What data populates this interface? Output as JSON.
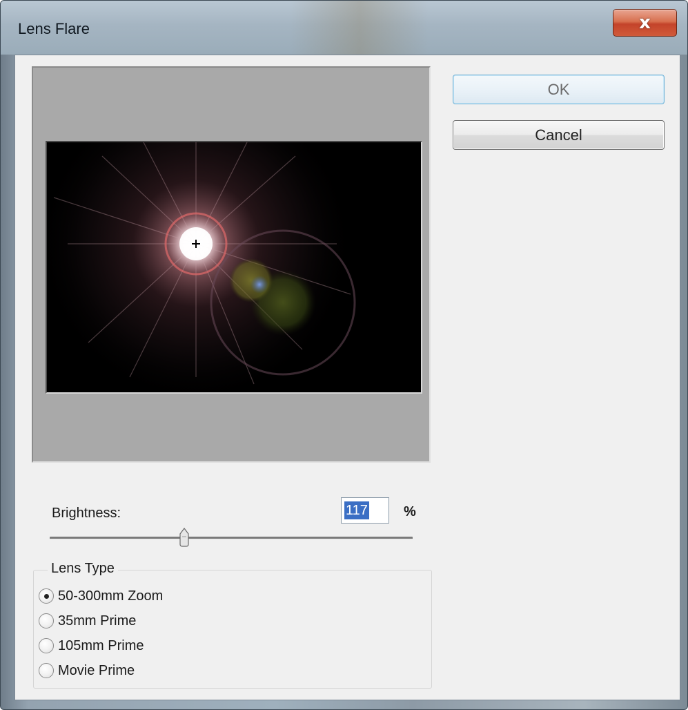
{
  "window": {
    "title": "Lens Flare",
    "close_glyph": "x"
  },
  "buttons": {
    "ok_label": "OK",
    "cancel_label": "Cancel"
  },
  "brightness": {
    "label": "Brightness:",
    "value": "117",
    "unit": "%",
    "slider_value_percent": 117,
    "slider_range": [
      10,
      300
    ]
  },
  "lens_type": {
    "legend": "Lens Type",
    "options": [
      {
        "label": "50-300mm Zoom",
        "checked": true
      },
      {
        "label": "35mm Prime",
        "checked": false
      },
      {
        "label": "105mm Prime",
        "checked": false
      },
      {
        "label": "Movie Prime",
        "checked": false
      }
    ]
  },
  "colors": {
    "client_bg": "#f0f0f0",
    "preview_bg": "#a9a9a9",
    "selection_bg": "#3a6ec4",
    "close_red": "#c4432a",
    "ok_border": "#6fb1d6"
  },
  "icons": {
    "close": "close-icon",
    "crosshair": "crosshair-icon",
    "slider_thumb": "slider-thumb-icon"
  }
}
